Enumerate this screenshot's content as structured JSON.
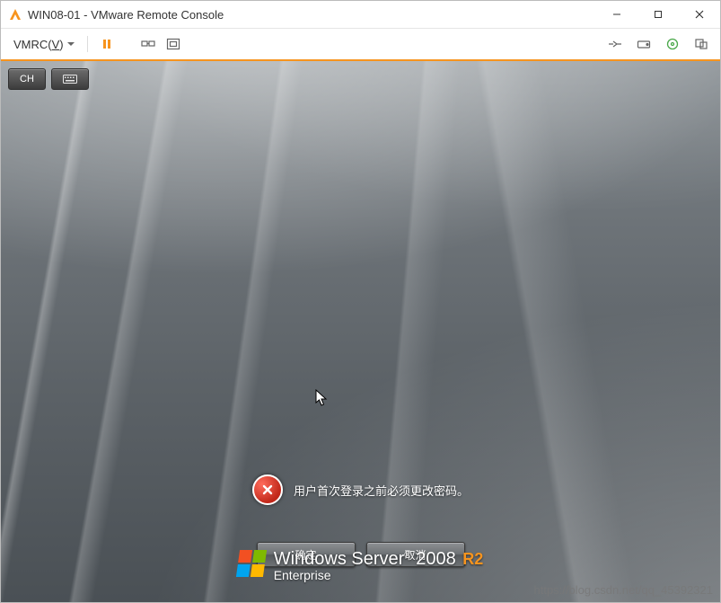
{
  "window": {
    "title": "WIN08-01 - VMware Remote Console"
  },
  "toolbar": {
    "menu_label": "VMRC(",
    "menu_key": "V",
    "menu_label_end": ")"
  },
  "console": {
    "ime_label": "CH",
    "message": "用户首次登录之前必须更改密码。",
    "ok_label": "确定",
    "cancel_label": "取消",
    "brand_prefix": "Windows",
    "brand_word": "Server",
    "brand_year": "2008",
    "brand_tag": "R2",
    "brand_edition": "Enterprise"
  },
  "watermark": "https://blog.csdn.net/qq_45392321"
}
